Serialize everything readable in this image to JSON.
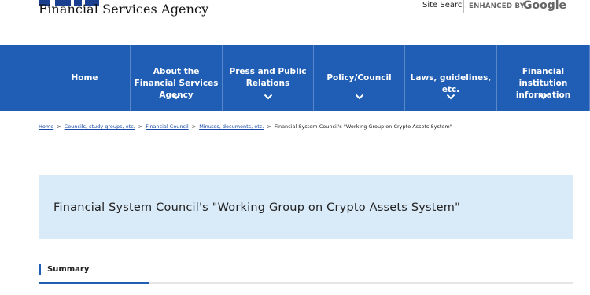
{
  "header": {
    "logo_text": "Financial Services Agency",
    "site_search_label": "Site Search",
    "search_enhanced": "ENHANCED BY",
    "search_google": "Google"
  },
  "nav": {
    "items": [
      {
        "label": "Home"
      },
      {
        "label": "About the Financial Services Agency"
      },
      {
        "label": "Press and Public Relations"
      },
      {
        "label": "Policy/Council"
      },
      {
        "label": "Laws, guidelines, etc."
      },
      {
        "label": "Financial institution information"
      }
    ]
  },
  "breadcrumb": {
    "items": [
      "Home",
      "Councils, study groups, etc.",
      "Financial Council",
      "Minutes, documents, etc."
    ],
    "current": "Financial System Council's \"Working Group on Crypto Assets System\"",
    "separator": ">"
  },
  "page": {
    "title": "Financial System Council's \"Working Group on Crypto Assets System\"",
    "summary_heading": "Summary"
  },
  "colors": {
    "brand_blue": "#1f5eb4",
    "title_panel_bg": "#d9eaf8",
    "link": "#1a49a8"
  }
}
